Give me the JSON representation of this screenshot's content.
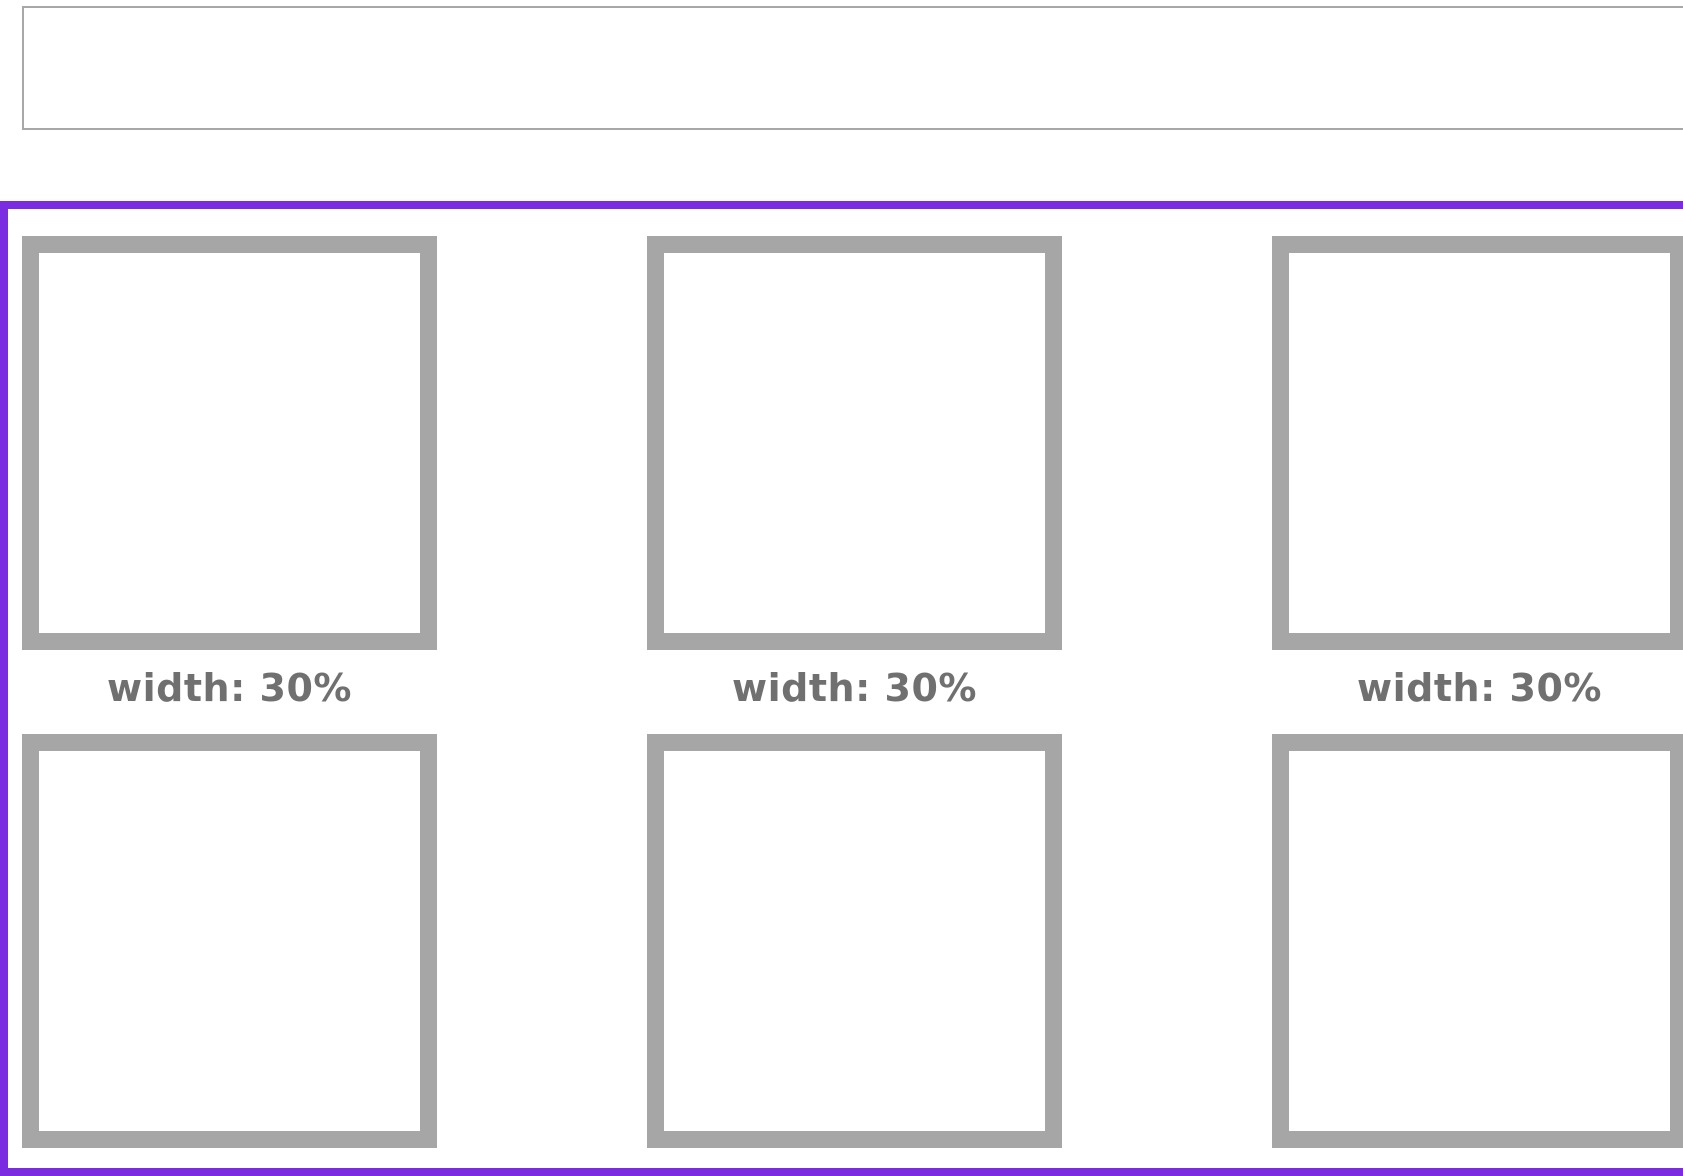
{
  "colors": {
    "container_border": "#7b2be0",
    "box_border": "#a6a6a6",
    "top_bar_border": "#a8a8a8",
    "caption_text": "#707070"
  },
  "captions": [
    {
      "label": "width: 30%"
    },
    {
      "label": "width: 30%"
    },
    {
      "label": "width: 30%"
    }
  ]
}
